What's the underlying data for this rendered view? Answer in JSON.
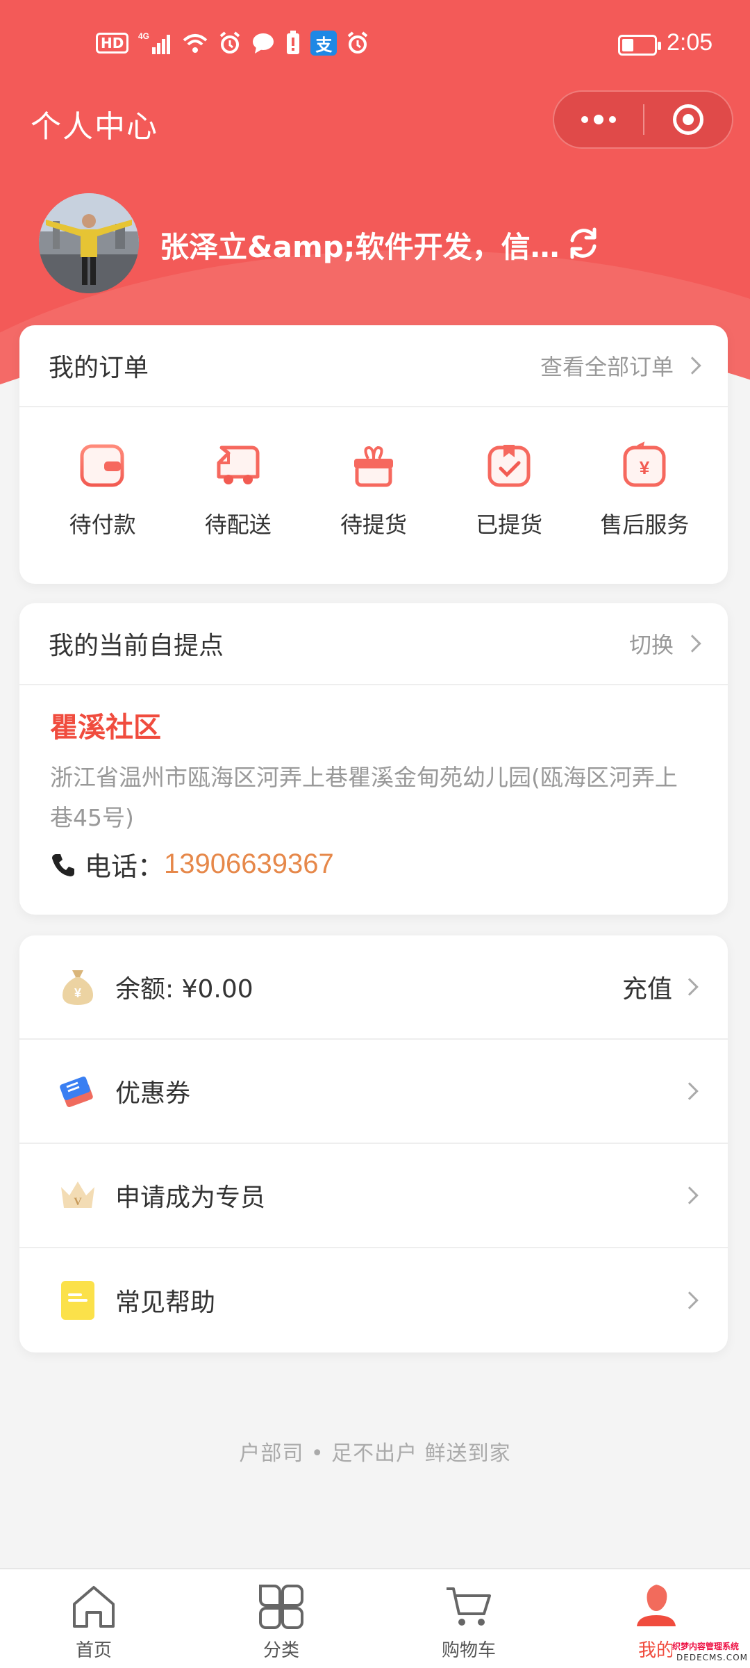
{
  "status_bar": {
    "left_icons": [
      "HD",
      "4G",
      "signal",
      "wifi",
      "alarm",
      "message",
      "battery-warning",
      "alipay",
      "alarm"
    ],
    "time": "2:05"
  },
  "header": {
    "title": "个人中心",
    "user_name": "张泽立&amp;软件开发，信…"
  },
  "orders": {
    "title": "我的订单",
    "view_all": "查看全部订单",
    "items": [
      {
        "label": "待付款",
        "icon": "wallet-icon"
      },
      {
        "label": "待配送",
        "icon": "delivery-truck-icon"
      },
      {
        "label": "待提货",
        "icon": "gift-box-icon"
      },
      {
        "label": "已提货",
        "icon": "bag-check-icon"
      },
      {
        "label": "售后服务",
        "icon": "yuan-refund-icon"
      }
    ]
  },
  "pickup": {
    "title": "我的当前自提点",
    "switch": "切换",
    "name": "瞿溪社区",
    "address": "浙江省温州市瓯海区河弄上巷瞿溪金甸苑幼儿园(瓯海区河弄上巷45号)",
    "phone_label": "电话：",
    "phone": "13906639367"
  },
  "menu": {
    "balance_label": "余额: ¥0.00",
    "recharge": "充值",
    "coupon": "优惠券",
    "apply": "申请成为专员",
    "help": "常见帮助"
  },
  "slogan": "户部司 • 足不出户 鲜送到家",
  "tabbar": {
    "home": "首页",
    "category": "分类",
    "cart": "购物车",
    "mine": "我的"
  },
  "watermark": {
    "line1": "织梦内容管理系统",
    "line2": "DEDECMS.COM"
  },
  "colors": {
    "brand_red": "#f35a58",
    "accent_red": "#f04c3e",
    "phone_orange": "#e6884a"
  }
}
